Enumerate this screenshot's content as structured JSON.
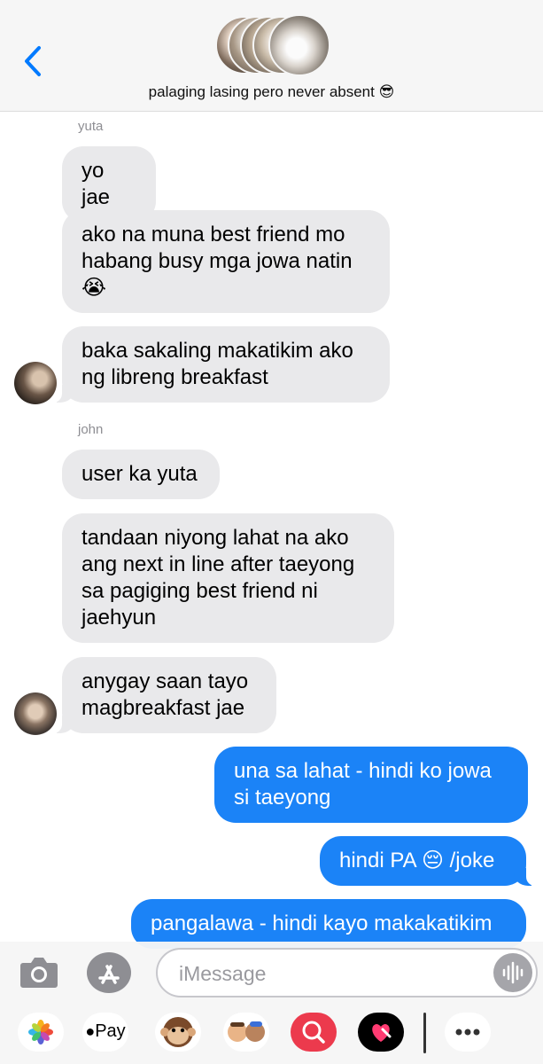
{
  "header": {
    "back_icon": "chevron-left-icon",
    "group_title": "palaging lasing pero never absent 😎"
  },
  "messages": [
    {
      "sender": "yuta",
      "text": "yo jae"
    },
    {
      "text": "ako na muna best friend mo habang busy mga jowa natin 😭"
    },
    {
      "text": "baka sakaling makatikim ako ng libreng breakfast"
    },
    {
      "sender": "john",
      "text": "user ka yuta"
    },
    {
      "text": "tandaan niyong lahat na ako ang next in line after taeyong sa pagiging best friend ni jaehyun"
    },
    {
      "text": "anygay saan tayo magbreakfast jae"
    },
    {
      "text": "una sa lahat - hindi ko jowa si taeyong"
    },
    {
      "text": "hindi PA 😔 /joke"
    },
    {
      "text": "pangalawa - hindi kayo makakatikim"
    }
  ],
  "compose": {
    "placeholder": "iMessage"
  },
  "apps": {
    "pay_label": "Pay"
  },
  "colors": {
    "outgoing": "#1b83f7",
    "incoming": "#e9e9eb",
    "accent": "#007aff"
  }
}
